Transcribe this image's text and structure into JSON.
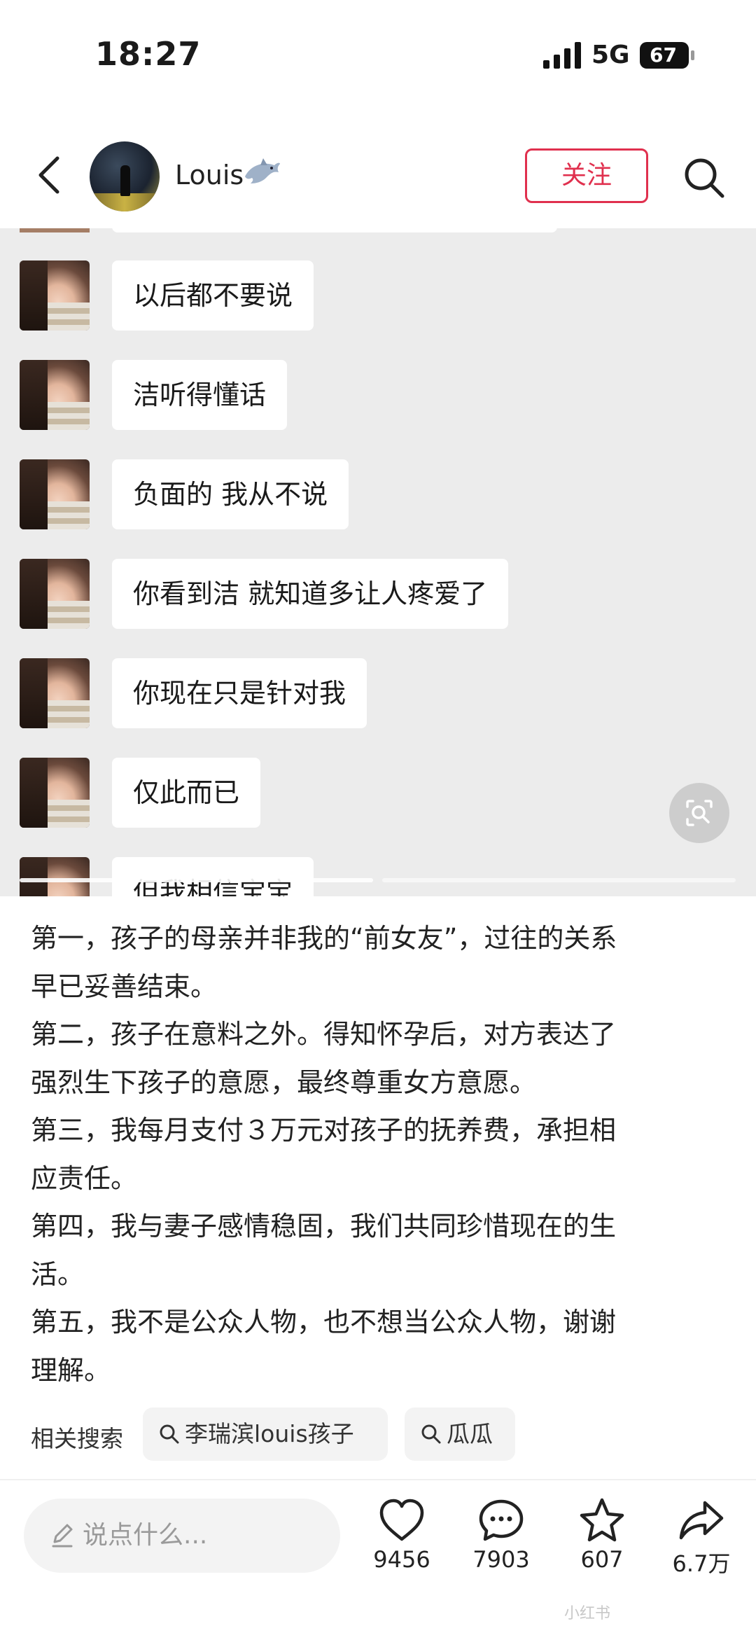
{
  "status_bar": {
    "time": "18:27",
    "network": "5G",
    "battery": "67"
  },
  "header": {
    "username": "Louis",
    "follow_label": "关注"
  },
  "chat_messages": [
    {
      "text": "以后都不要说"
    },
    {
      "text": "洁听得懂话"
    },
    {
      "text": "负面的 我从不说"
    },
    {
      "text": "你看到洁 就知道多让人疼爱了"
    },
    {
      "text": "你现在只是针对我"
    },
    {
      "text": "仅此而已"
    },
    {
      "text": "但我相信宝宝"
    }
  ],
  "post_lines": [
    "第一，孩子的母亲并非我的“前女友”，过往的关系",
    "早已妥善结束。",
    "第二，孩子在意料之外。得知怀孕后，对方表达了",
    "强烈生下孩子的意愿，最终尊重女方意愿。",
    "第三，我每月支付３万元对孩子的抚养费，承担相",
    "应责任。",
    "第四，我与妻子感情稳固，我们共同珍惜现在的生",
    "活。",
    "第五，我不是公众人物，也不想当公众人物，谢谢",
    "理解。"
  ],
  "related_search": {
    "label": "相关搜索",
    "items": [
      "李瑞滨louis孩子",
      "瓜瓜"
    ]
  },
  "bottom_bar": {
    "comment_placeholder": "说点什么...",
    "likes": "9456",
    "comments": "7903",
    "favorites": "607",
    "shares": "6.7万"
  },
  "watermark": "小红书",
  "colors": {
    "accent": "#e0304e",
    "chat_bg": "#ececec",
    "bubble": "#ffffff"
  },
  "icons": [
    "back-icon",
    "dolphin-icon",
    "search-icon",
    "scan-icon",
    "pencil-icon",
    "heart-icon",
    "comment-icon",
    "star-icon",
    "share-icon"
  ]
}
